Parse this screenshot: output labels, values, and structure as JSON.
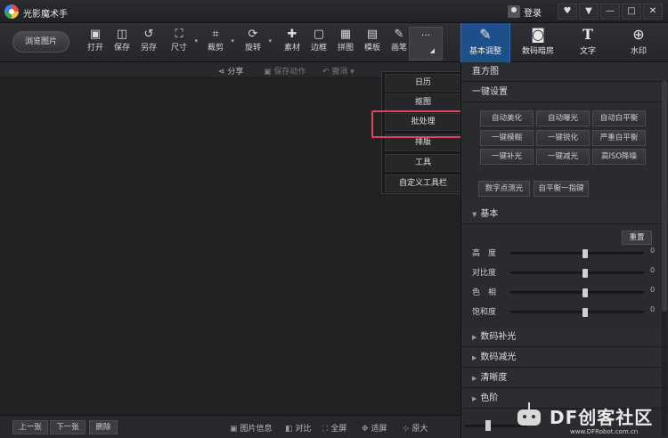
{
  "window": {
    "title": "光影魔术手",
    "login_label": "登录",
    "controls": [
      "♥",
      "▼",
      "—",
      "□",
      "✕"
    ]
  },
  "toolbar": {
    "browse_label": "浏览图片",
    "tools": [
      {
        "label": "打开",
        "icon": "open-icon",
        "glyph": "▣"
      },
      {
        "label": "保存",
        "icon": "save-icon",
        "glyph": "◫"
      },
      {
        "label": "另存",
        "icon": "save-as-icon",
        "glyph": "↺"
      },
      {
        "label": "尺寸",
        "icon": "resize-icon",
        "glyph": "⛶"
      },
      {
        "label": "裁剪",
        "icon": "crop-icon",
        "glyph": "⌗"
      },
      {
        "label": "旋转",
        "icon": "rotate-icon",
        "glyph": "⟳"
      },
      {
        "label": "素材",
        "icon": "material-icon",
        "glyph": "✚"
      },
      {
        "label": "边框",
        "icon": "border-icon",
        "glyph": "▢"
      },
      {
        "label": "拼图",
        "icon": "collage-icon",
        "glyph": "▦"
      },
      {
        "label": "模板",
        "icon": "template-icon",
        "glyph": "▤"
      },
      {
        "label": "画笔",
        "icon": "brush-icon",
        "glyph": "✎"
      }
    ],
    "more_glyph": "···",
    "more_caret": "◢"
  },
  "right_tabs": [
    {
      "label": "基本调整",
      "icon": "basic-adjust-icon",
      "glyph": "✎",
      "active": true
    },
    {
      "label": "数码暗房",
      "icon": "darkroom-icon",
      "glyph": "◙",
      "active": false
    },
    {
      "label": "文字",
      "icon": "text-icon",
      "glyph": "T",
      "active": false
    },
    {
      "label": "水印",
      "icon": "watermark-icon",
      "glyph": "⊕",
      "active": false
    }
  ],
  "subbar": {
    "share": "分享",
    "save_action": "保存动作",
    "undo": "撤消"
  },
  "dropdown_menu": {
    "items": [
      "日历",
      "抠图",
      "批处理",
      "排版",
      "工具",
      "自定义工具栏"
    ],
    "highlighted": "批处理"
  },
  "panel": {
    "histogram_title": "直方图",
    "one_click_title": "一键设置",
    "one_click_buttons": [
      "自动美化",
      "自动曝光",
      "自动白平衡",
      "一键模糊",
      "一键锐化",
      "严重白平衡",
      "一键补光",
      "一键减光",
      "高ISO降噪"
    ],
    "extra_buttons": [
      "数字点测光",
      "自平衡一指键"
    ],
    "basic_title": "基本",
    "reset_label": "重置",
    "sliders": [
      {
        "label": "高　度",
        "value": "0",
        "level": 0.56
      },
      {
        "label": "对比度",
        "value": "0",
        "level": 0.56
      },
      {
        "label": "色　相",
        "value": "0",
        "level": 0.56
      },
      {
        "label": "饱和度",
        "value": "0",
        "level": 0.56
      }
    ],
    "sections": [
      "数码补光",
      "数码减光",
      "清晰度",
      "色阶"
    ]
  },
  "bottombar": {
    "prev": "上一张",
    "next": "下一张",
    "delete": "删除",
    "info": "图片信息",
    "compare": "对比",
    "fullscreen": "全屏",
    "fit": "适屏",
    "original": "原大"
  },
  "watermark": {
    "text": "DF创客社区",
    "sub": "www.DFRobot.com.cn"
  },
  "colors": {
    "accent": "#1f4f8a",
    "highlight": "#e2405f"
  }
}
